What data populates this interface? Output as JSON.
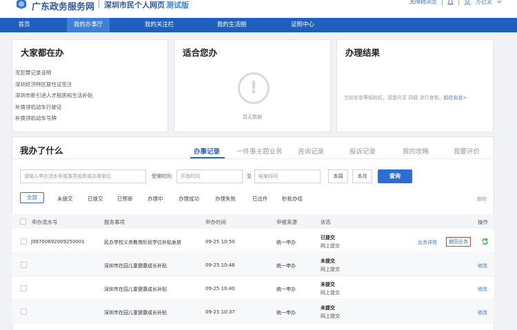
{
  "header": {
    "brand": "广东政务服务网",
    "subtitle": "深圳市民个人网页",
    "test_tag": "测试版",
    "accessibility": "无障碍浏览",
    "user": "方已文"
  },
  "nav": {
    "items": [
      {
        "label": "首页"
      },
      {
        "label": "我的办事厅"
      },
      {
        "label": "我的关注栏"
      },
      {
        "label": "我的生活圈"
      },
      {
        "label": "证照中心"
      }
    ]
  },
  "panels": {
    "popular": {
      "title": "大家都在办",
      "items": [
        "无犯罪记录证明",
        "深圳经济特区居住证签注",
        "深圳市新引进人才租房和生活补贴",
        "补换领机动车行驶证",
        "补换领机动车号牌"
      ]
    },
    "suitable": {
      "title": "适合您办",
      "empty_text": "暂无数据"
    },
    "results": {
      "title": "办理结果",
      "message": "当前实名等级较低，请提升至 四级 进行查看。",
      "link": "前往实名>"
    }
  },
  "main": {
    "title": "我办了什么",
    "tabs": [
      "办事记录",
      "一件事主题业务",
      "咨询记录",
      "投诉记录",
      "我的攻略",
      "我要评价"
    ],
    "search": {
      "placeholder": "请输入申办流水号或事项名称或办理单位",
      "time_label": "受理时间:",
      "start_placeholder": "开始时间",
      "to_label": "至",
      "end_placeholder": "结束时间",
      "week_button": "本周",
      "month_button": "本月",
      "query_button": "查询"
    },
    "filters": [
      "全部",
      "未提交",
      "已提交",
      "已预审",
      "办理中",
      "办理成功",
      "办理失败",
      "已出件",
      "秒批办结"
    ],
    "delete_label": "删除",
    "columns": [
      "申办流水号",
      "服务事项",
      "申办时间",
      "申报来源",
      "状态",
      "操作"
    ],
    "rows": [
      {
        "id": "J09700692009250001",
        "item": "民办学校义务教育阶段学位补贴发放",
        "time": "09-25 10:50",
        "source": "统一申办",
        "status": "已提交",
        "channel": "网上提交",
        "ops": [
          "业务详情",
          "撤回业务"
        ]
      },
      {
        "id": "",
        "item": "深圳市在园儿童健康成长补贴",
        "time": "09-25 10:46",
        "source": "统一申办",
        "status": "未提交",
        "channel": "网上提交",
        "ops": [
          "修改"
        ]
      },
      {
        "id": "",
        "item": "深圳市在园儿童健康成长补贴",
        "time": "09-25 10:40",
        "source": "统一申办",
        "status": "未提交",
        "channel": "网上提交",
        "ops": [
          "修改"
        ]
      },
      {
        "id": "",
        "item": "深圳市在园儿童健康成长补贴",
        "time": "09-25 10:37",
        "source": "统一申办",
        "status": "未提交",
        "channel": "网上提交",
        "ops": [
          "修改"
        ]
      }
    ]
  },
  "colors": {
    "brand_blue": "#2b58a8",
    "nav_blue": "#1f5fbe",
    "nav_active": "#3f7fd7",
    "primary": "#2e6ed3",
    "highlight_red": "#e33b3b",
    "refresh_green": "#2fb14a"
  },
  "icons": [
    "logo-icon",
    "bell-icon",
    "user-icon",
    "chevron-down-icon",
    "exclamation-icon",
    "refresh-icon",
    "checkbox-icon"
  ]
}
